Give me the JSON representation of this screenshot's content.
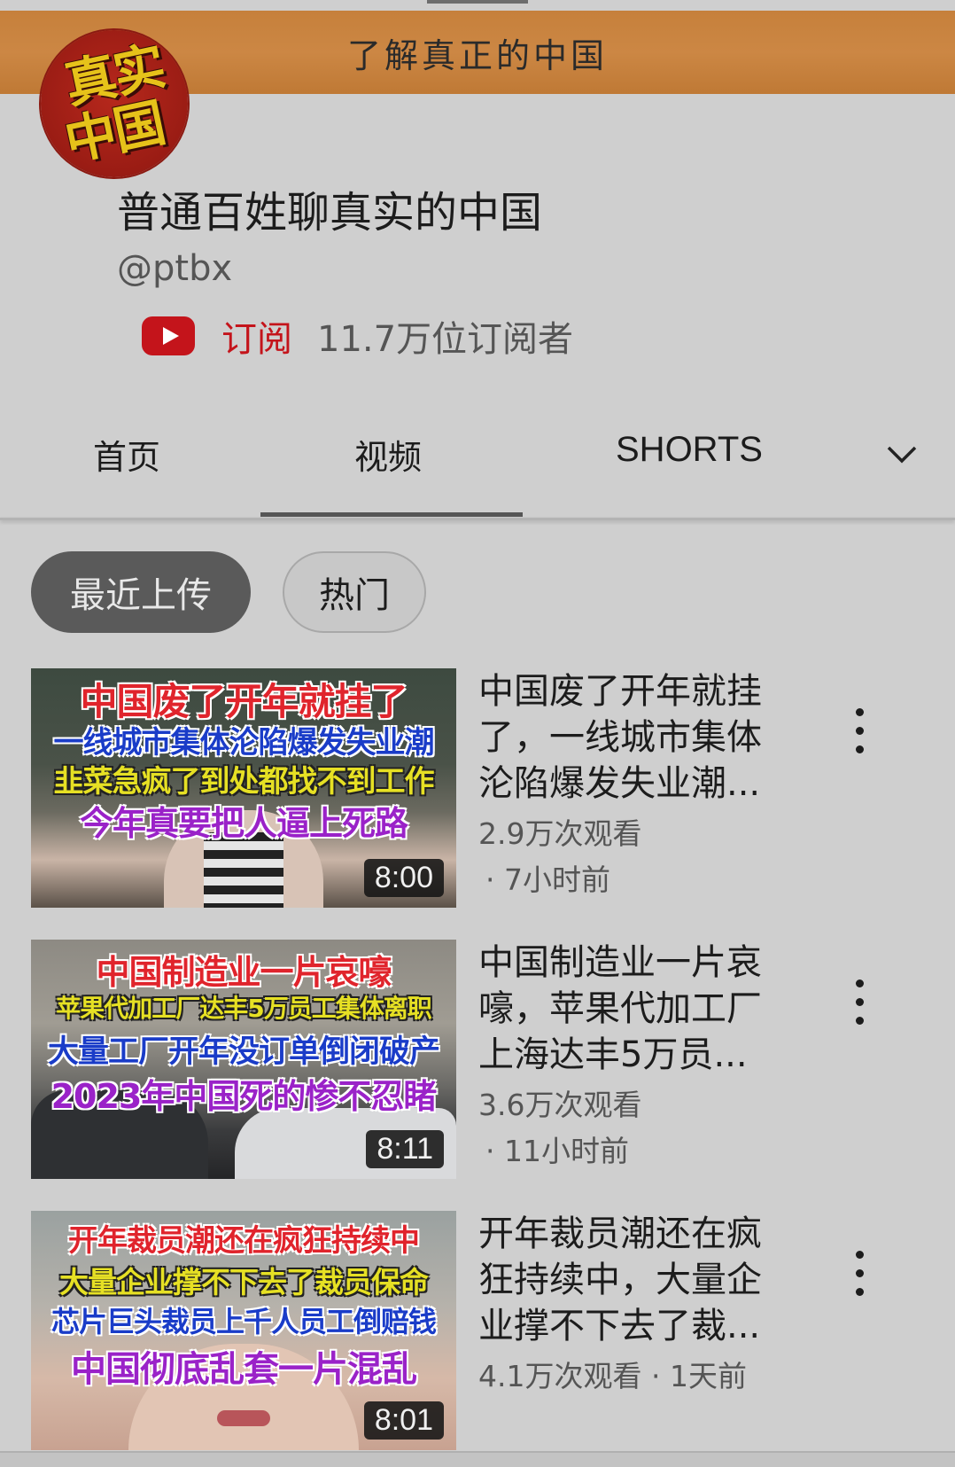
{
  "banner": {
    "text": "了解真正的中国"
  },
  "avatar": {
    "line1": "真实",
    "line2": "中国"
  },
  "channel": {
    "name": "普通百姓聊真实的中国",
    "handle": "@ptbx",
    "subscribe_label": "订阅",
    "subscriber_count": "11.7万位订阅者"
  },
  "tabs": [
    {
      "label": "首页"
    },
    {
      "label": "视频"
    },
    {
      "label": "SHORTS"
    }
  ],
  "chips": [
    {
      "label": "最近上传",
      "selected": true
    },
    {
      "label": "热门",
      "selected": false
    }
  ],
  "videos": [
    {
      "thumb_lines": [
        "中国废了开年就挂了",
        "一线城市集体沦陷爆发失业潮",
        "韭菜急疯了到处都找不到工作",
        "今年真要把人逼上死路"
      ],
      "duration": "8:00",
      "title": "中国废了开年就挂了，一线城市集体沦陷爆发失业潮...",
      "views": "2.9万次观看",
      "time": "· 7小时前"
    },
    {
      "thumb_lines": [
        "中国制造业一片哀嚎",
        "苹果代加工厂达丰5万员工集体离职",
        "大量工厂开年没订单倒闭破产",
        "2023年中国死的惨不忍睹"
      ],
      "duration": "8:11",
      "title": "中国制造业一片哀嚎，苹果代加工厂上海达丰5万员...",
      "views": "3.6万次观看",
      "time": "· 11小时前"
    },
    {
      "thumb_lines": [
        "开年裁员潮还在疯狂持续中",
        "大量企业撑不下去了裁员保命",
        "芯片巨头裁员上千人员工倒赔钱",
        "中国彻底乱套一片混乱"
      ],
      "duration": "8:01",
      "title": "开年裁员潮还在疯狂持续中，大量企业撑不下去了裁...",
      "views": "4.1万次观看",
      "time": "· 1天前"
    }
  ],
  "colors": {
    "accent_red": "#c4141b",
    "banner": "#c9833f"
  }
}
